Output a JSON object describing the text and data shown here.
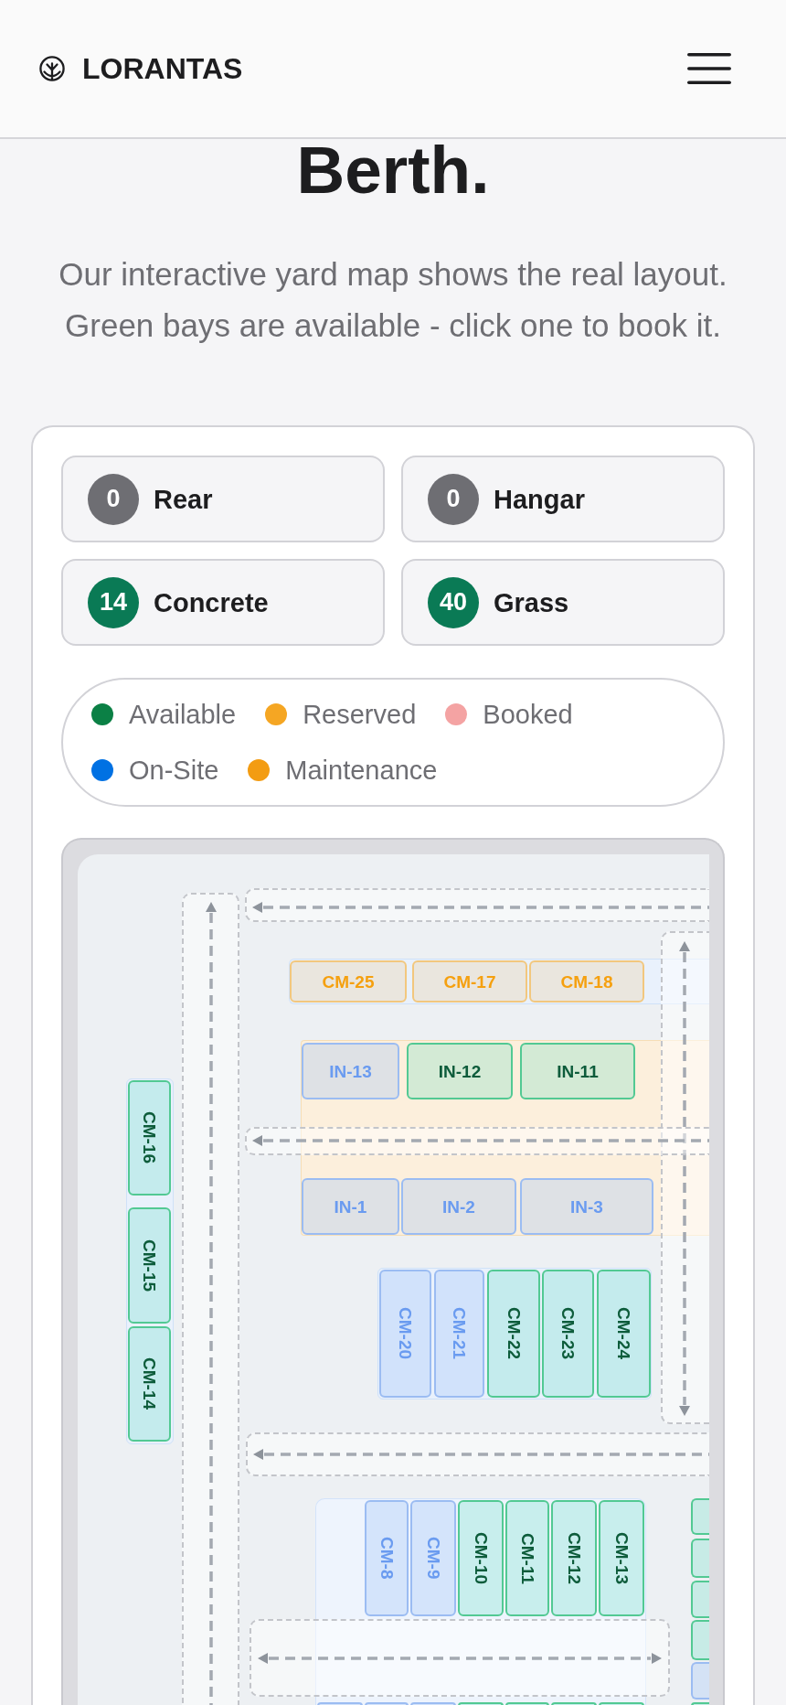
{
  "header": {
    "brand": "LORANTAS"
  },
  "hero": {
    "title": "Berth.",
    "subtitle": "Our interactive yard map shows the real layout. Green bays are available - click one to book it."
  },
  "stats": [
    {
      "count": "0",
      "label": "Rear",
      "color": "#6e6e73"
    },
    {
      "count": "0",
      "label": "Hangar",
      "color": "#6e6e73"
    },
    {
      "count": "14",
      "label": "Concrete",
      "color": "#0a7a55"
    },
    {
      "count": "40",
      "label": "Grass",
      "color": "#0a7a55"
    }
  ],
  "legend": [
    {
      "label": "Available",
      "color": "#0b8045"
    },
    {
      "label": "Reserved",
      "color": "#f5a623"
    },
    {
      "label": "Booked",
      "color": "#f4a3a3"
    },
    {
      "label": "On-Site",
      "color": "#0071e3"
    },
    {
      "label": "Maintenance",
      "color": "#f39c12"
    }
  ],
  "yard_map": {
    "lanes": [
      {
        "two_way": false
      },
      {
        "two_way": false
      },
      {
        "two_way": true
      },
      {
        "two_way": false
      },
      {
        "two_way": false
      },
      {
        "two_way": true
      }
    ],
    "bays": [
      {
        "label": "CM-25",
        "kind": "reserved"
      },
      {
        "label": "CM-17",
        "kind": "reserved"
      },
      {
        "label": "CM-18",
        "kind": "reserved"
      },
      {
        "label": "IN-13",
        "kind": "onsite"
      },
      {
        "label": "IN-12",
        "kind": "available"
      },
      {
        "label": "IN-11",
        "kind": "available"
      },
      {
        "label": "IN-1",
        "kind": "onsite"
      },
      {
        "label": "IN-2",
        "kind": "onsite"
      },
      {
        "label": "IN-3",
        "kind": "onsite"
      },
      {
        "label": "CM-16",
        "kind": "available"
      },
      {
        "label": "CM-15",
        "kind": "available"
      },
      {
        "label": "CM-14",
        "kind": "available"
      },
      {
        "label": "CM-20",
        "kind": "onsite"
      },
      {
        "label": "CM-21",
        "kind": "onsite"
      },
      {
        "label": "CM-22",
        "kind": "available"
      },
      {
        "label": "CM-23",
        "kind": "available"
      },
      {
        "label": "CM-24",
        "kind": "available"
      },
      {
        "label": "CM-8",
        "kind": "onsite"
      },
      {
        "label": "CM-9",
        "kind": "onsite"
      },
      {
        "label": "CM-10",
        "kind": "available"
      },
      {
        "label": "CM-11",
        "kind": "available"
      },
      {
        "label": "CM-12",
        "kind": "available"
      },
      {
        "label": "CM-13",
        "kind": "available"
      },
      {
        "kind": "available"
      },
      {
        "kind": "available"
      },
      {
        "kind": "available"
      },
      {
        "kind": "available"
      },
      {
        "kind": "onsite"
      },
      {
        "kind": "available"
      },
      {
        "kind": "onsite"
      },
      {
        "kind": "onsite"
      },
      {
        "kind": "onsite"
      },
      {
        "kind": "available"
      },
      {
        "kind": "available"
      },
      {
        "kind": "available"
      },
      {
        "kind": "available"
      }
    ]
  }
}
